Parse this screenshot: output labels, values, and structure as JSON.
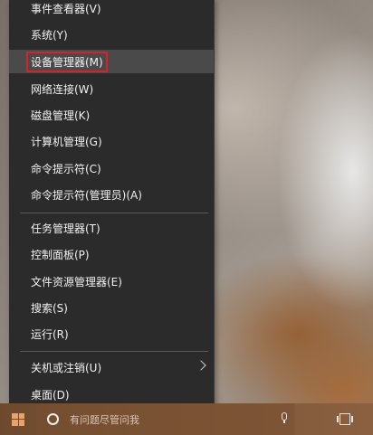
{
  "menu": {
    "items": [
      {
        "label": "事件查看器(V)"
      },
      {
        "label": "系统(Y)"
      },
      {
        "label": "设备管理器(M)"
      },
      {
        "label": "网络连接(W)"
      },
      {
        "label": "磁盘管理(K)"
      },
      {
        "label": "计算机管理(G)"
      },
      {
        "label": "命令提示符(C)"
      },
      {
        "label": "命令提示符(管理员)(A)"
      },
      {
        "label": "任务管理器(T)"
      },
      {
        "label": "控制面板(P)"
      },
      {
        "label": "文件资源管理器(E)"
      },
      {
        "label": "搜索(S)"
      },
      {
        "label": "运行(R)"
      },
      {
        "label": "关机或注销(U)"
      },
      {
        "label": "桌面(D)"
      }
    ],
    "highlighted_item": "设备管理器(M)",
    "highlight_color": "#d8222a"
  },
  "taskbar": {
    "search_placeholder": "有问题尽管问我",
    "icons": [
      "windows-start-icon",
      "cortana-icon",
      "microphone-icon",
      "task-view-icon"
    ]
  }
}
